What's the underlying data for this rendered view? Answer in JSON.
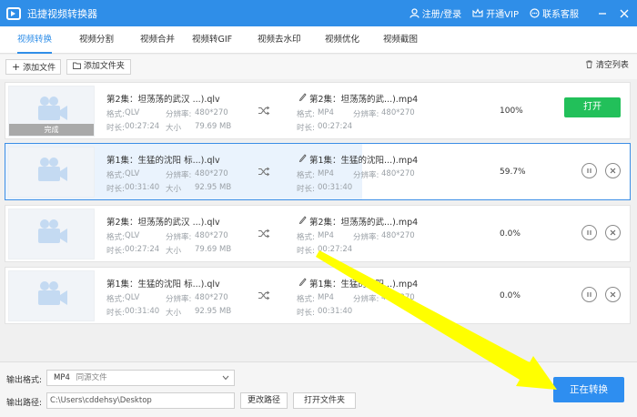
{
  "app": {
    "title": "迅捷视频转换器"
  },
  "header": {
    "login": "注册/登录",
    "vip": "开通VIP",
    "support": "联系客服"
  },
  "tabs": [
    {
      "label": "视频转换",
      "active": true
    },
    {
      "label": "视频分割"
    },
    {
      "label": "视频合并"
    },
    {
      "label": "视频转GIF"
    },
    {
      "label": "视频去水印"
    },
    {
      "label": "视频优化"
    },
    {
      "label": "视频截图"
    }
  ],
  "toolbar": {
    "add_file": "添加文件",
    "add_folder": "添加文件夹",
    "clear_list": "清空列表"
  },
  "labels": {
    "format": "格式:",
    "resolution": "分辨率:",
    "duration": "时长:",
    "size": "大小",
    "done": "完成",
    "open": "打开"
  },
  "items": [
    {
      "src_name": "第2集：坦荡荡的武汉 ...).qlv",
      "src_format": "QLV",
      "src_res": "480*270",
      "src_duration": "00:27:24",
      "src_size": "79.69 MB",
      "dst_name": "第2集：坦荡荡的武...).mp4",
      "dst_format": "MP4",
      "dst_res": "480*270",
      "dst_duration": "00:27:24",
      "progress": "100%"
    },
    {
      "src_name": "第1集：生猛的沈阳 标...).qlv",
      "src_format": "QLV",
      "src_res": "480*270",
      "src_duration": "00:31:40",
      "src_size": "92.95 MB",
      "dst_name": "第1集：生猛的沈阳...).mp4",
      "dst_format": "MP4",
      "dst_res": "480*270",
      "dst_duration": "00:31:40",
      "progress": "59.7%"
    },
    {
      "src_name": "第2集：坦荡荡的武汉 ...).qlv",
      "src_format": "QLV",
      "src_res": "480*270",
      "src_duration": "00:27:24",
      "src_size": "79.69 MB",
      "dst_name": "第2集：坦荡荡的武...).mp4",
      "dst_format": "MP4",
      "dst_res": "480*270",
      "dst_duration": "00:27:24",
      "progress": "0.0%"
    },
    {
      "src_name": "第1集：生猛的沈阳 标...).qlv",
      "src_format": "QLV",
      "src_res": "480*270",
      "src_duration": "00:31:40",
      "src_size": "92.95 MB",
      "dst_name": "第1集：生猛的沈阳...).mp4",
      "dst_format": "MP4",
      "dst_res": "480*270",
      "dst_duration": "00:31:40",
      "progress": "0.0%"
    }
  ],
  "bottom": {
    "format_label": "输出格式:",
    "format_value": "MP4",
    "format_sub": "同源文件",
    "path_label": "输出路径:",
    "path_value": "C:\\Users\\cddehsy\\Desktop",
    "change_path": "更改路径",
    "open_folder": "打开文件夹",
    "convert": "正在转换"
  },
  "colors": {
    "primary": "#2f8ee8",
    "open_button": "#22c05a",
    "annotation_arrow": "#ffff00"
  }
}
